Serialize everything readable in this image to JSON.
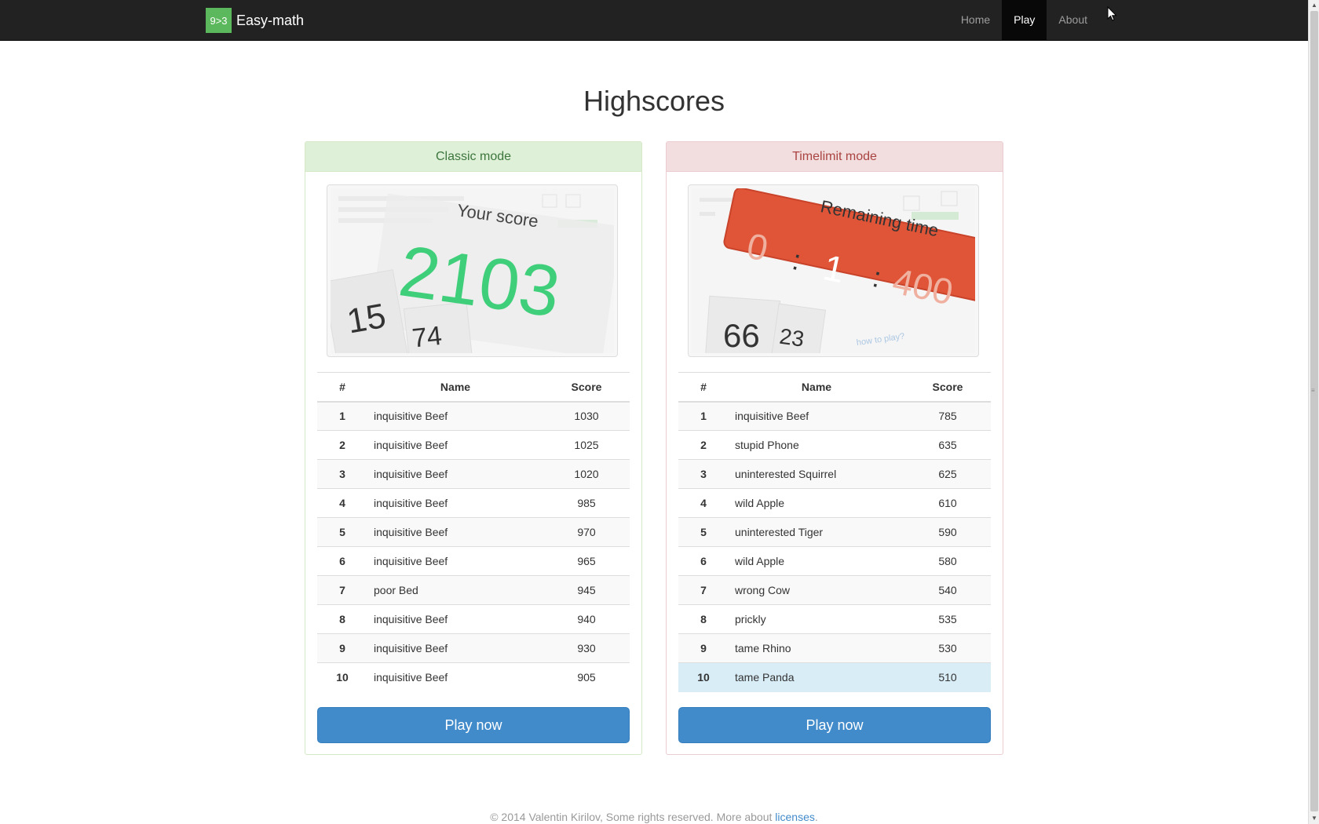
{
  "navbar": {
    "logo_text": "9>3",
    "brand": "Easy-math",
    "links": [
      {
        "label": "Home",
        "active": false
      },
      {
        "label": "Play",
        "active": true
      },
      {
        "label": "About",
        "active": false
      }
    ]
  },
  "page_title": "Highscores",
  "classic": {
    "heading": "Classic mode",
    "thumbnail": {
      "caption": "Your score",
      "score": "2103",
      "card_a": "15",
      "card_b": "74"
    },
    "columns": [
      "#",
      "Name",
      "Score"
    ],
    "rows": [
      {
        "rank": "1",
        "name": "inquisitive Beef",
        "score": "1030"
      },
      {
        "rank": "2",
        "name": "inquisitive Beef",
        "score": "1025"
      },
      {
        "rank": "3",
        "name": "inquisitive Beef",
        "score": "1020"
      },
      {
        "rank": "4",
        "name": "inquisitive Beef",
        "score": "985"
      },
      {
        "rank": "5",
        "name": "inquisitive Beef",
        "score": "970"
      },
      {
        "rank": "6",
        "name": "inquisitive Beef",
        "score": "965"
      },
      {
        "rank": "7",
        "name": "poor Bed",
        "score": "945"
      },
      {
        "rank": "8",
        "name": "inquisitive Beef",
        "score": "940"
      },
      {
        "rank": "9",
        "name": "inquisitive Beef",
        "score": "930"
      },
      {
        "rank": "10",
        "name": "inquisitive Beef",
        "score": "905"
      }
    ],
    "button": "Play now"
  },
  "timelimit": {
    "heading": "Timelimit mode",
    "thumbnail": {
      "caption": "Remaining time",
      "min": "0",
      "sep1": ":",
      "sec": "1",
      "sep2": ":",
      "ms": "400",
      "card_a": "66",
      "card_b": "23",
      "faint_text": "how to play?"
    },
    "columns": [
      "#",
      "Name",
      "Score"
    ],
    "rows": [
      {
        "rank": "1",
        "name": "inquisitive Beef",
        "score": "785"
      },
      {
        "rank": "2",
        "name": "stupid Phone",
        "score": "635"
      },
      {
        "rank": "3",
        "name": "uninterested Squirrel",
        "score": "625"
      },
      {
        "rank": "4",
        "name": "wild Apple",
        "score": "610"
      },
      {
        "rank": "5",
        "name": "uninterested Tiger",
        "score": "590"
      },
      {
        "rank": "6",
        "name": "wild Apple",
        "score": "580"
      },
      {
        "rank": "7",
        "name": "wrong Cow",
        "score": "540"
      },
      {
        "rank": "8",
        "name": "prickly",
        "score": "535"
      },
      {
        "rank": "9",
        "name": "tame Rhino",
        "score": "530"
      },
      {
        "rank": "10",
        "name": "tame Panda",
        "score": "510",
        "highlighted": true
      }
    ],
    "button": "Play now"
  },
  "footer": {
    "text": "© 2014 Valentin Kirilov, Some rights reserved. More about ",
    "link": "licenses",
    "end": "."
  },
  "colors": {
    "navbar": "#222222",
    "brand_logo": "#5cb85c",
    "button": "#428bca",
    "score_green": "#3fcf7a",
    "timer_red": "#e05538"
  }
}
